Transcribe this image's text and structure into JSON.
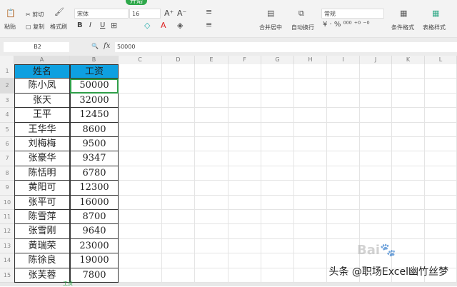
{
  "ribbon": {
    "active_tab": "开始",
    "clipboard": {
      "paste": "粘贴",
      "cut": "剪切",
      "copy": "复制",
      "format_painter": "格式刷"
    },
    "font": {
      "name": "宋体",
      "size": "16",
      "bold": "B",
      "italic": "I",
      "underline": "U"
    },
    "merge": "合并居中",
    "wrap": "自动换行",
    "number_format": "常规",
    "conditional_format": "条件格式",
    "table_style": "表格样式"
  },
  "formula_bar": {
    "name_box": "B2",
    "fx": "fx",
    "value": "50000"
  },
  "columns": [
    "A",
    "B",
    "C",
    "D",
    "E",
    "F",
    "G",
    "H",
    "I",
    "J",
    "K",
    "L"
  ],
  "rows": [
    "1",
    "2",
    "3",
    "4",
    "5",
    "6",
    "7",
    "8",
    "9",
    "10",
    "11",
    "12",
    "13",
    "14",
    "15"
  ],
  "table": {
    "headers": [
      "姓名",
      "工资"
    ],
    "data": [
      [
        "陈小凤",
        "50000"
      ],
      [
        "张天",
        "32000"
      ],
      [
        "王平",
        "12450"
      ],
      [
        "王华华",
        "8600"
      ],
      [
        "刘梅梅",
        "9500"
      ],
      [
        "张豪华",
        "9347"
      ],
      [
        "陈恬明",
        "6780"
      ],
      [
        "黄阳可",
        "12300"
      ],
      [
        "张平可",
        "16000"
      ],
      [
        "陈雪萍",
        "8700"
      ],
      [
        "张雪刚",
        "9640"
      ],
      [
        "黄瑞荣",
        "23000"
      ],
      [
        "陈徐良",
        "19000"
      ],
      [
        "张芙蓉",
        "7800"
      ]
    ]
  },
  "sheet_tab": "工资",
  "watermark": "头条 @职场Excel幽竹丝梦",
  "baidu_logo": "Baidu经验",
  "colors": {
    "header_fill": "#0ea0e0",
    "active_tab": "#2ea84a",
    "selection": "#2e9e48"
  }
}
